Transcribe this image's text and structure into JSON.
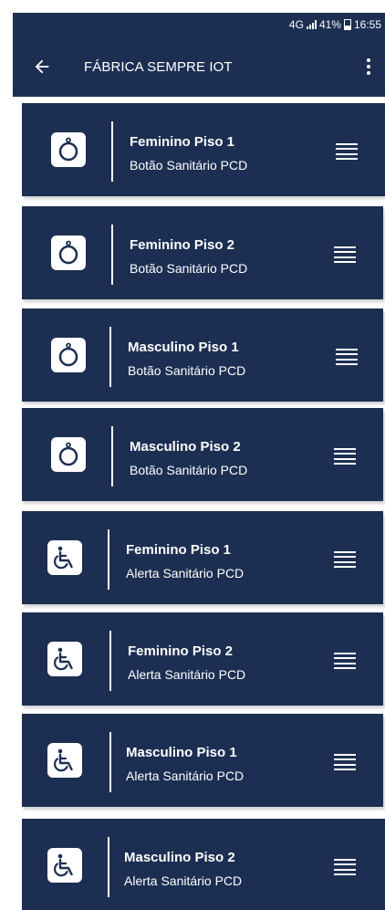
{
  "status_bar": {
    "network": "4G",
    "battery": "41%",
    "time": "16:55"
  },
  "app_bar": {
    "title": "FÁBRICA SEMPRE IOT",
    "back_icon": "arrow-left-icon",
    "menu_icon": "more-vertical-icon"
  },
  "colors": {
    "primary": "#1c2f52",
    "on_primary": "#ffffff"
  },
  "devices": [
    {
      "title": "Feminino Piso 1",
      "subtitle": "Botão Sanitário PCD",
      "icon": "push-button-icon"
    },
    {
      "title": "Feminino Piso 2",
      "subtitle": "Botão Sanitário PCD",
      "icon": "push-button-icon"
    },
    {
      "title": "Masculino Piso 1",
      "subtitle": "Botão Sanitário PCD",
      "icon": "push-button-icon"
    },
    {
      "title": "Masculino Piso 2",
      "subtitle": "Botão Sanitário PCD",
      "icon": "push-button-icon"
    },
    {
      "title": "Feminino Piso 1",
      "subtitle": "Alerta Sanitário PCD",
      "icon": "wheelchair-icon"
    },
    {
      "title": "Feminino Piso 2",
      "subtitle": "Alerta Sanitário PCD",
      "icon": "wheelchair-icon"
    },
    {
      "title": "Masculino Piso 1",
      "subtitle": "Alerta Sanitário PCD",
      "icon": "wheelchair-icon"
    },
    {
      "title": "Masculino Piso 2",
      "subtitle": "Alerta Sanitário PCD",
      "icon": "wheelchair-icon"
    }
  ]
}
